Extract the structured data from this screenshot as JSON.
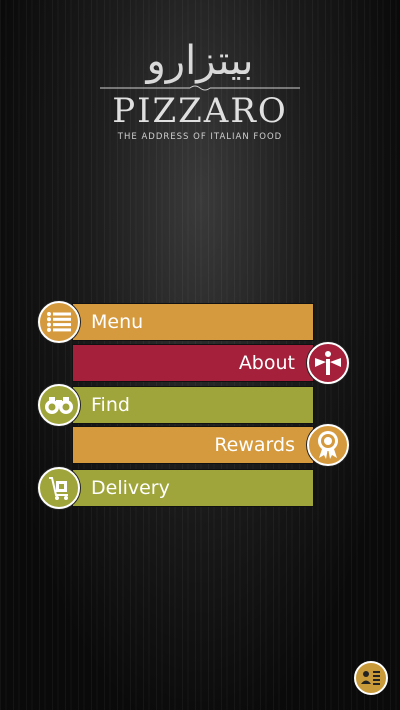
{
  "brand": {
    "arabic_name": "بيتزارو",
    "name": "PIZZARO",
    "tagline": "THE ADDRESS OF ITALIAN FOOD"
  },
  "menu": {
    "items": [
      {
        "label": "Menu",
        "icon": "list-icon",
        "color": "#d59a3e"
      },
      {
        "label": "About",
        "icon": "info-bow-icon",
        "color": "#a5203a"
      },
      {
        "label": "Find",
        "icon": "binoculars-icon",
        "color": "#9fa53b"
      },
      {
        "label": "Rewards",
        "icon": "award-rosette-icon",
        "color": "#d59a3e"
      },
      {
        "label": "Delivery",
        "icon": "delivery-cart-icon",
        "color": "#9fa53b"
      }
    ]
  },
  "footer": {
    "icon": "contact-card-icon"
  }
}
